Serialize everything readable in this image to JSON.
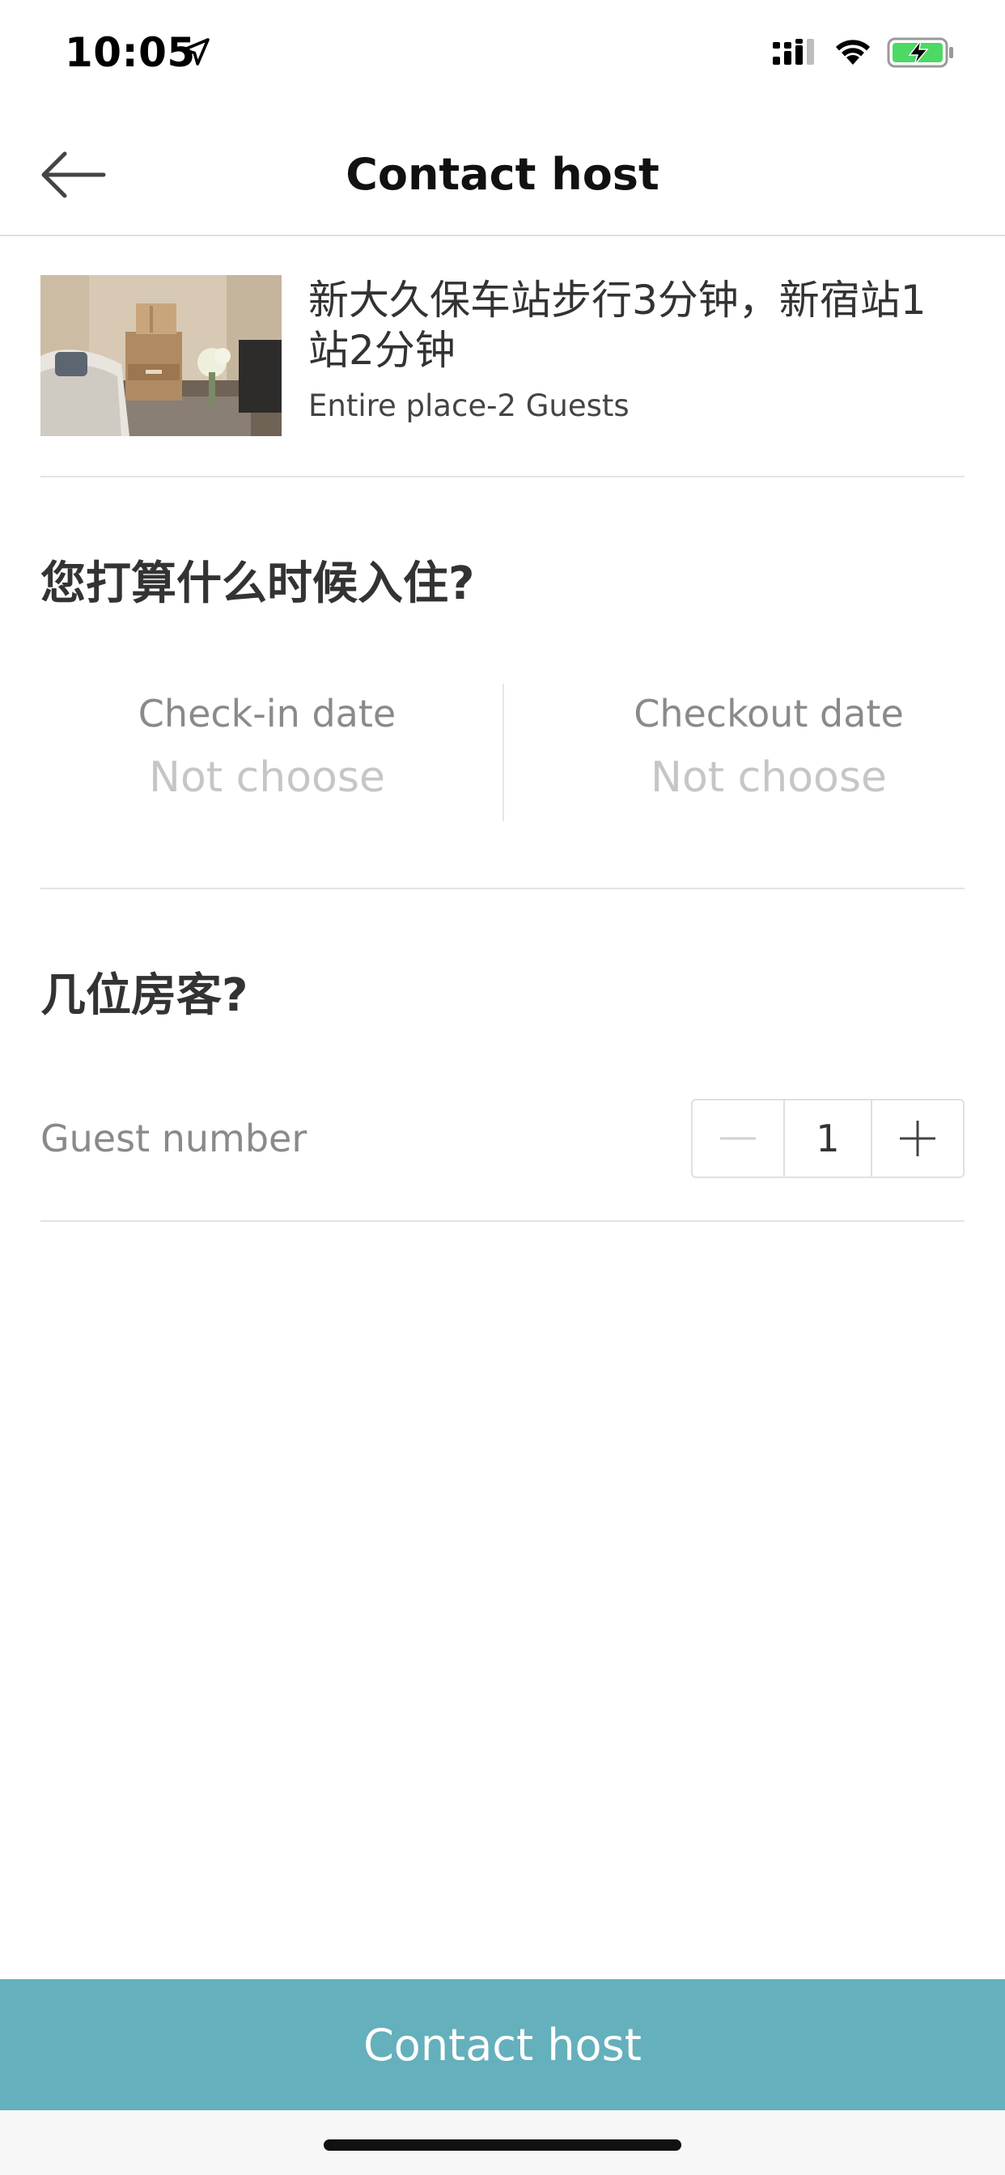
{
  "status_bar": {
    "time": "10:05"
  },
  "nav": {
    "title": "Contact host"
  },
  "listing": {
    "title": "新大久保车站步行3分钟，新宿站1站2分钟",
    "subtitle": "Entire place-2 Guests"
  },
  "dates_section": {
    "heading": "您打算什么时候入住?",
    "checkin_label": "Check-in date",
    "checkin_value": "Not choose",
    "checkout_label": "Checkout date",
    "checkout_value": "Not choose"
  },
  "guests_section": {
    "heading": "几位房客?",
    "label": "Guest number",
    "value": "1"
  },
  "cta": {
    "label": "Contact host"
  },
  "colors": {
    "accent": "#64b0bd",
    "battery": "#4cd964"
  }
}
